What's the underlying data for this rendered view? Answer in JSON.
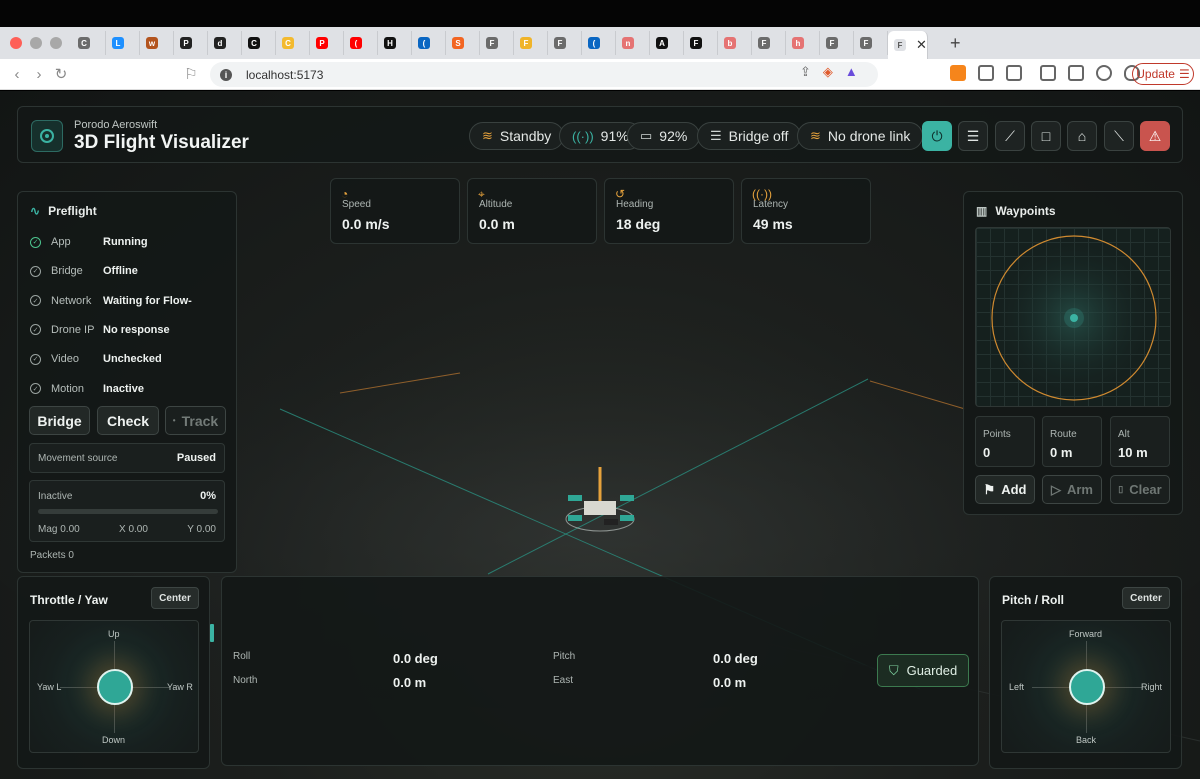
{
  "browser": {
    "tabs": [
      {
        "letter": "C",
        "color": "#6b6b6b"
      },
      {
        "letter": "L",
        "color": "#1e90ff"
      },
      {
        "letter": "w",
        "color": "#b3541e"
      },
      {
        "letter": "P",
        "color": "#222222"
      },
      {
        "letter": "d",
        "color": "#222222"
      },
      {
        "letter": "C",
        "color": "#111111"
      },
      {
        "letter": "C",
        "color": "#f3ba2f"
      },
      {
        "letter": "P",
        "color": "#ff0000"
      },
      {
        "letter": "(",
        "color": "#ff0000"
      },
      {
        "letter": "H",
        "color": "#111111"
      },
      {
        "letter": "(",
        "color": "#0a66c2"
      },
      {
        "letter": "S",
        "color": "#f26522"
      },
      {
        "letter": "F",
        "color": "#6b6b6b"
      },
      {
        "letter": "F",
        "color": "#f0b429"
      },
      {
        "letter": "F",
        "color": "#6b6b6b"
      },
      {
        "letter": "(",
        "color": "#0a66c2"
      },
      {
        "letter": "n",
        "color": "#e57373"
      },
      {
        "letter": "A",
        "color": "#111111"
      },
      {
        "letter": "F",
        "color": "#111111"
      },
      {
        "letter": "b",
        "color": "#e57373"
      },
      {
        "letter": "F",
        "color": "#6b6b6b"
      },
      {
        "letter": "h",
        "color": "#e57373"
      },
      {
        "letter": "F",
        "color": "#6b6b6b"
      },
      {
        "letter": "F",
        "color": "#6b6b6b"
      }
    ],
    "active_tab": "F",
    "url": "localhost:5173",
    "update_label": "Update"
  },
  "header": {
    "subtitle": "Porodo Aeroswift",
    "title": "3D Flight Visualizer",
    "pills": {
      "status": "Standby",
      "signal": "91%",
      "battery": "92%",
      "bridge": "Bridge off",
      "link": "No drone link"
    },
    "icons": [
      "power-icon",
      "server-icon",
      "takeoff-icon",
      "stop-icon",
      "home-icon",
      "land-icon",
      "alert-icon"
    ]
  },
  "telemetry": {
    "speed": {
      "label": "Speed",
      "value": "0.0 m/s"
    },
    "altitude": {
      "label": "Altitude",
      "value": "0.0 m"
    },
    "heading": {
      "label": "Heading",
      "value": "18 deg"
    },
    "latency": {
      "label": "Latency",
      "value": "49 ms"
    }
  },
  "preflight": {
    "title": "Preflight",
    "rows": [
      {
        "label": "App",
        "value": "Running"
      },
      {
        "label": "Bridge",
        "value": "Offline"
      },
      {
        "label": "Network",
        "value": "Waiting for Flow-"
      },
      {
        "label": "Drone IP",
        "value": "No response"
      },
      {
        "label": "Video",
        "value": "Unchecked"
      },
      {
        "label": "Motion",
        "value": "Inactive"
      }
    ],
    "buttons": {
      "bridge": "Bridge",
      "check": "Check",
      "track": "Track"
    },
    "movement": {
      "label": "Movement source",
      "value": "Paused"
    },
    "motion": {
      "label": "Inactive",
      "percent_text": "0%",
      "progress": 0,
      "mag": "Mag 0.00",
      "x": "X 0.00",
      "y": "Y 0.00"
    },
    "packets": "Packets 0"
  },
  "waypoints": {
    "title": "Waypoints",
    "stats": [
      {
        "label": "Points",
        "value": "0"
      },
      {
        "label": "Route",
        "value": "0 m"
      },
      {
        "label": "Alt",
        "value": "10 m"
      }
    ],
    "buttons": {
      "add": "Add",
      "arm": "Arm",
      "clear": "Clear"
    }
  },
  "throttle_yaw": {
    "title": "Throttle / Yaw",
    "center": "Center",
    "up": "Up",
    "down": "Down",
    "left": "Yaw L",
    "right": "Yaw R"
  },
  "pitch_roll": {
    "title": "Pitch / Roll",
    "center": "Center",
    "up": "Forward",
    "down": "Back",
    "left": "Left",
    "right": "Right"
  },
  "attitude": {
    "roll_label": "Roll",
    "roll_value": "0.0 deg",
    "pitch_label": "Pitch",
    "pitch_value": "0.0 deg",
    "north_label": "North",
    "north_value": "0.0 m",
    "east_label": "East",
    "east_value": "0.0 m",
    "guard": "Guarded"
  },
  "colors": {
    "accent": "#3bb3a3",
    "warning": "#e6a23c",
    "danger": "#c9544e",
    "background": "#161a19"
  }
}
